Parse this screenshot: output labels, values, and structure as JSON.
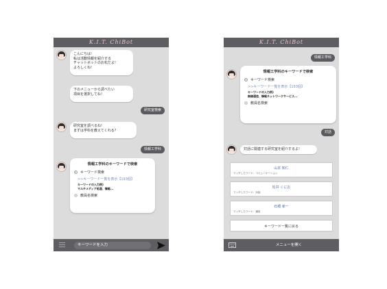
{
  "app_title": "K.I.T. ChiBot",
  "left": {
    "greeting_lines": [
      "こんにちは!",
      "私は活動情報を紹介する",
      "チャットボットのお松だよ!",
      "よろしくね!"
    ],
    "menu_prompt_lines": [
      "下のメニューから調べたい",
      "項目を選択してね！"
    ],
    "reply_1": "研究室検索",
    "dept_prompt_lines": [
      "研究室を調べるね!",
      "まずは学科を教えてくれる?"
    ],
    "reply_2": "情報工学科",
    "card": {
      "title": "情報工学科のキーワードで検索",
      "option_keyword": "キーワード検索",
      "link": ">>キーワード一覧を表示【193個】",
      "example_label": "キーワードの入力例)",
      "example_text": "マルチメディア処理、情報...",
      "option_teacher": "教員名検索"
    },
    "input_placeholder": "キーワードを入力"
  },
  "right": {
    "reply_top": "情報工学科",
    "card": {
      "title": "情報工学科のキーワードで検索",
      "option_keyword": "キーワード検索",
      "link": ">>キーワード一覧を表示【193個】",
      "example_label": "キーワードの入力例)",
      "example_text": "無線通信、情報ネットワークサービス...",
      "option_teacher": "教員名検索"
    },
    "reply_2": "対話",
    "lab_prompt": "対話に関連する研究室を紹介するよ!",
    "labs": [
      {
        "name": "山本 知仁",
        "match": "マッチしたワード：コミュニケーション"
      },
      {
        "name": "松井 くにお",
        "match": "マッチしたワード：対話"
      },
      {
        "name": "石橋 孝一",
        "match": "マッチしたワード：通信"
      }
    ],
    "back_button": "キーワード一覧に戻る",
    "menu_button": "メニューを開く"
  }
}
